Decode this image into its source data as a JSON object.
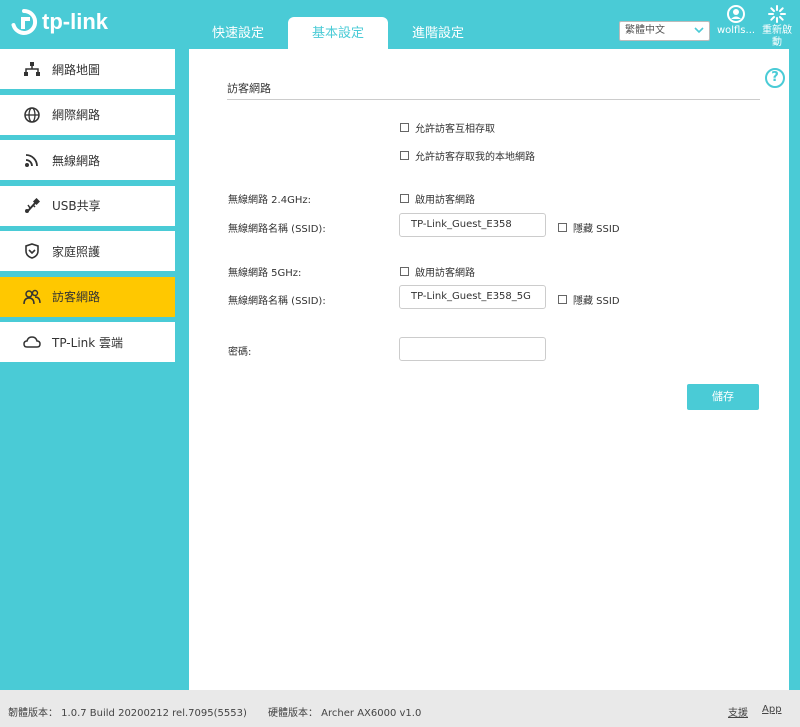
{
  "header": {
    "brand": "tp-link",
    "tabs": [
      {
        "label": "快速設定"
      },
      {
        "label": "基本設定"
      },
      {
        "label": "進階設定"
      }
    ],
    "language": "繁體中文",
    "user_label": "wolfls...",
    "reboot_label": "重新啟動"
  },
  "sidebar": {
    "items": [
      {
        "label": "網路地圖",
        "icon": "network-map-icon"
      },
      {
        "label": "網際網路",
        "icon": "globe-icon"
      },
      {
        "label": "無線網路",
        "icon": "wireless-icon"
      },
      {
        "label": "USB共享",
        "icon": "usb-icon"
      },
      {
        "label": "家庭照護",
        "icon": "shield-icon"
      },
      {
        "label": "訪客網路",
        "icon": "guests-icon"
      },
      {
        "label": "TP-Link 雲端",
        "icon": "cloud-icon"
      }
    ],
    "active_index": 5
  },
  "main": {
    "section_title": "訪客網路",
    "allow_guests_access_each_other": "允許訪客互相存取",
    "allow_guests_access_local": "允許訪客存取我的本地網路",
    "wifi24_label": "無線網路 2.4GHz:",
    "wifi24_enable": "啟用訪客網路",
    "ssid24_label": "無線網路名稱 (SSID):",
    "ssid24_value": "TP-Link_Guest_E358",
    "ssid24_hide": "隱藏 SSID",
    "wifi5_label": "無線網路 5GHz:",
    "wifi5_enable": "啟用訪客網路",
    "ssid5_label": "無線網路名稱 (SSID):",
    "ssid5_value": "TP-Link_Guest_E358_5G",
    "ssid5_hide": "隱藏 SSID",
    "password_label": "密碼:",
    "password_value": "",
    "save_label": "儲存",
    "help_symbol": "?"
  },
  "footer": {
    "firmware": "韌體版本： 1.0.7 Build 20200212 rel.7095(5553)",
    "hardware": "硬體版本： Archer AX6000 v1.0",
    "support": "支援",
    "app": "App"
  },
  "colors": {
    "accent": "#4acbd6",
    "active_menu": "#ffc800"
  }
}
